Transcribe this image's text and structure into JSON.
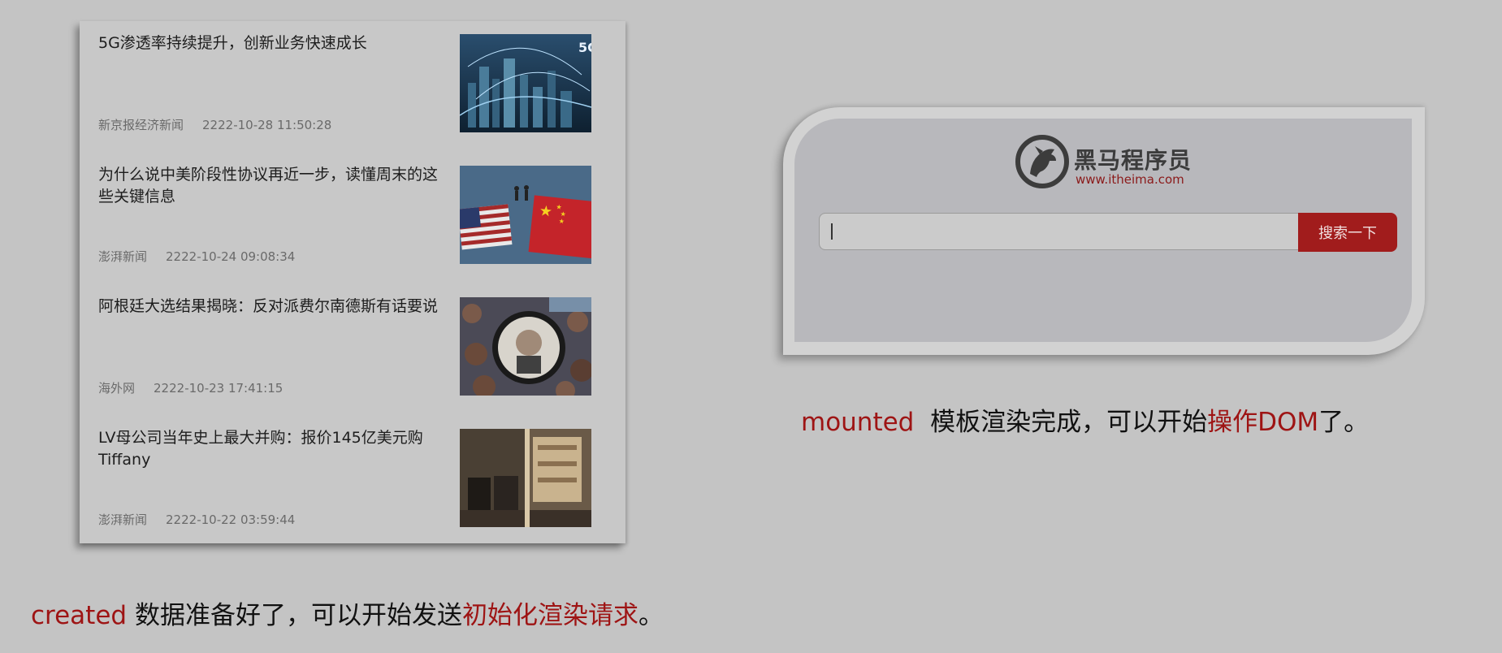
{
  "news": [
    {
      "title": "5G渗透率持续提升，创新业务快速成长",
      "source": "新京报经济新闻",
      "time": "2222-10-28 11:50:28",
      "thumb": "city-network-image"
    },
    {
      "title": "为什么说中美阶段性协议再近一步，读懂周末的这些关键信息",
      "source": "澎湃新闻",
      "time": "2222-10-24 09:08:34",
      "thumb": "us-china-flags-image"
    },
    {
      "title": "阿根廷大选结果揭晓：反对派费尔南德斯有话要说",
      "source": "海外网",
      "time": "2222-10-23 17:41:15",
      "thumb": "rally-crowd-image"
    },
    {
      "title": "LV母公司当年史上最大并购：报价145亿美元购Tiffany",
      "source": "澎湃新闻",
      "time": "2222-10-22 03:59:44",
      "thumb": "store-interior-image"
    }
  ],
  "search": {
    "logo_text": "黑马程序员",
    "logo_url": "www.itheima.com",
    "input_value": "",
    "button_label": "搜索一下"
  },
  "captions": {
    "mounted": {
      "keyword": "mounted",
      "text": "模板渲染完成，可以开始",
      "highlight": "操作DOM",
      "end": "了。"
    },
    "created": {
      "keyword": "created",
      "text": "数据准备好了，可以开始发送",
      "highlight": "初始化渲染请求",
      "end": "。"
    }
  },
  "colors": {
    "background": "#c4c4c4",
    "accent_red": "#9e1414",
    "button_red": "#a11c1c"
  }
}
